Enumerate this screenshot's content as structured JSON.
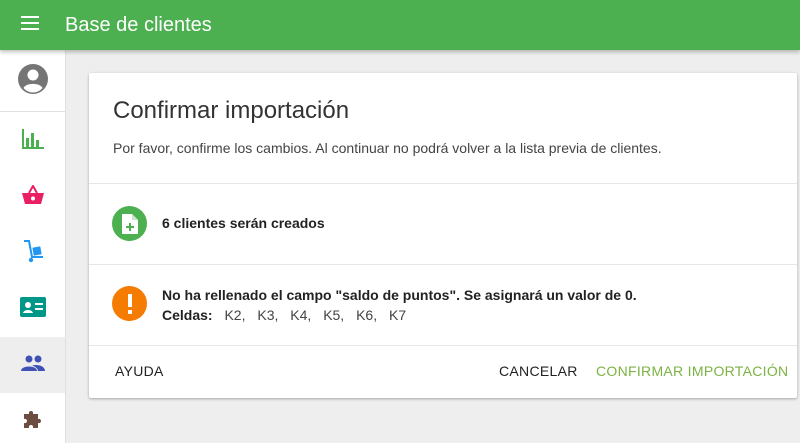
{
  "app": {
    "title": "Base de clientes",
    "accent_color": "#4caf50"
  },
  "sidebar": {
    "items": [
      {
        "icon": "account-circle-icon",
        "color": "#757575"
      },
      {
        "icon": "bar-chart-icon",
        "color": "#4caf50"
      },
      {
        "icon": "shopping-basket-icon",
        "color": "#e91e63"
      },
      {
        "icon": "hand-truck-icon",
        "color": "#2196f3"
      },
      {
        "icon": "contact-card-icon",
        "color": "#009688"
      },
      {
        "icon": "people-icon",
        "color": "#3f51b5",
        "active": true
      },
      {
        "icon": "puzzle-icon",
        "color": "#6d4c41"
      }
    ]
  },
  "dialog": {
    "title": "Confirmar importación",
    "subtitle": "Por favor, confirme los cambios. Al continuar no podrá volver a la lista previa de clientes.",
    "created": {
      "text": "6 clientes serán creados",
      "icon": "file-add-icon",
      "color": "#4caf50"
    },
    "warning": {
      "text": "No ha rellenado el campo \"saldo de puntos\". Se asignará un valor de 0.",
      "icon": "alert-icon",
      "color": "#f57c00",
      "cells_label": "Celdas:",
      "cells": [
        "K2,",
        "K3,",
        "K4,",
        "K5,",
        "K6,",
        "K7"
      ]
    },
    "buttons": {
      "help": "AYUDA",
      "cancel": "CANCELAR",
      "confirm": "CONFIRMAR IMPORTACIÓN"
    }
  }
}
